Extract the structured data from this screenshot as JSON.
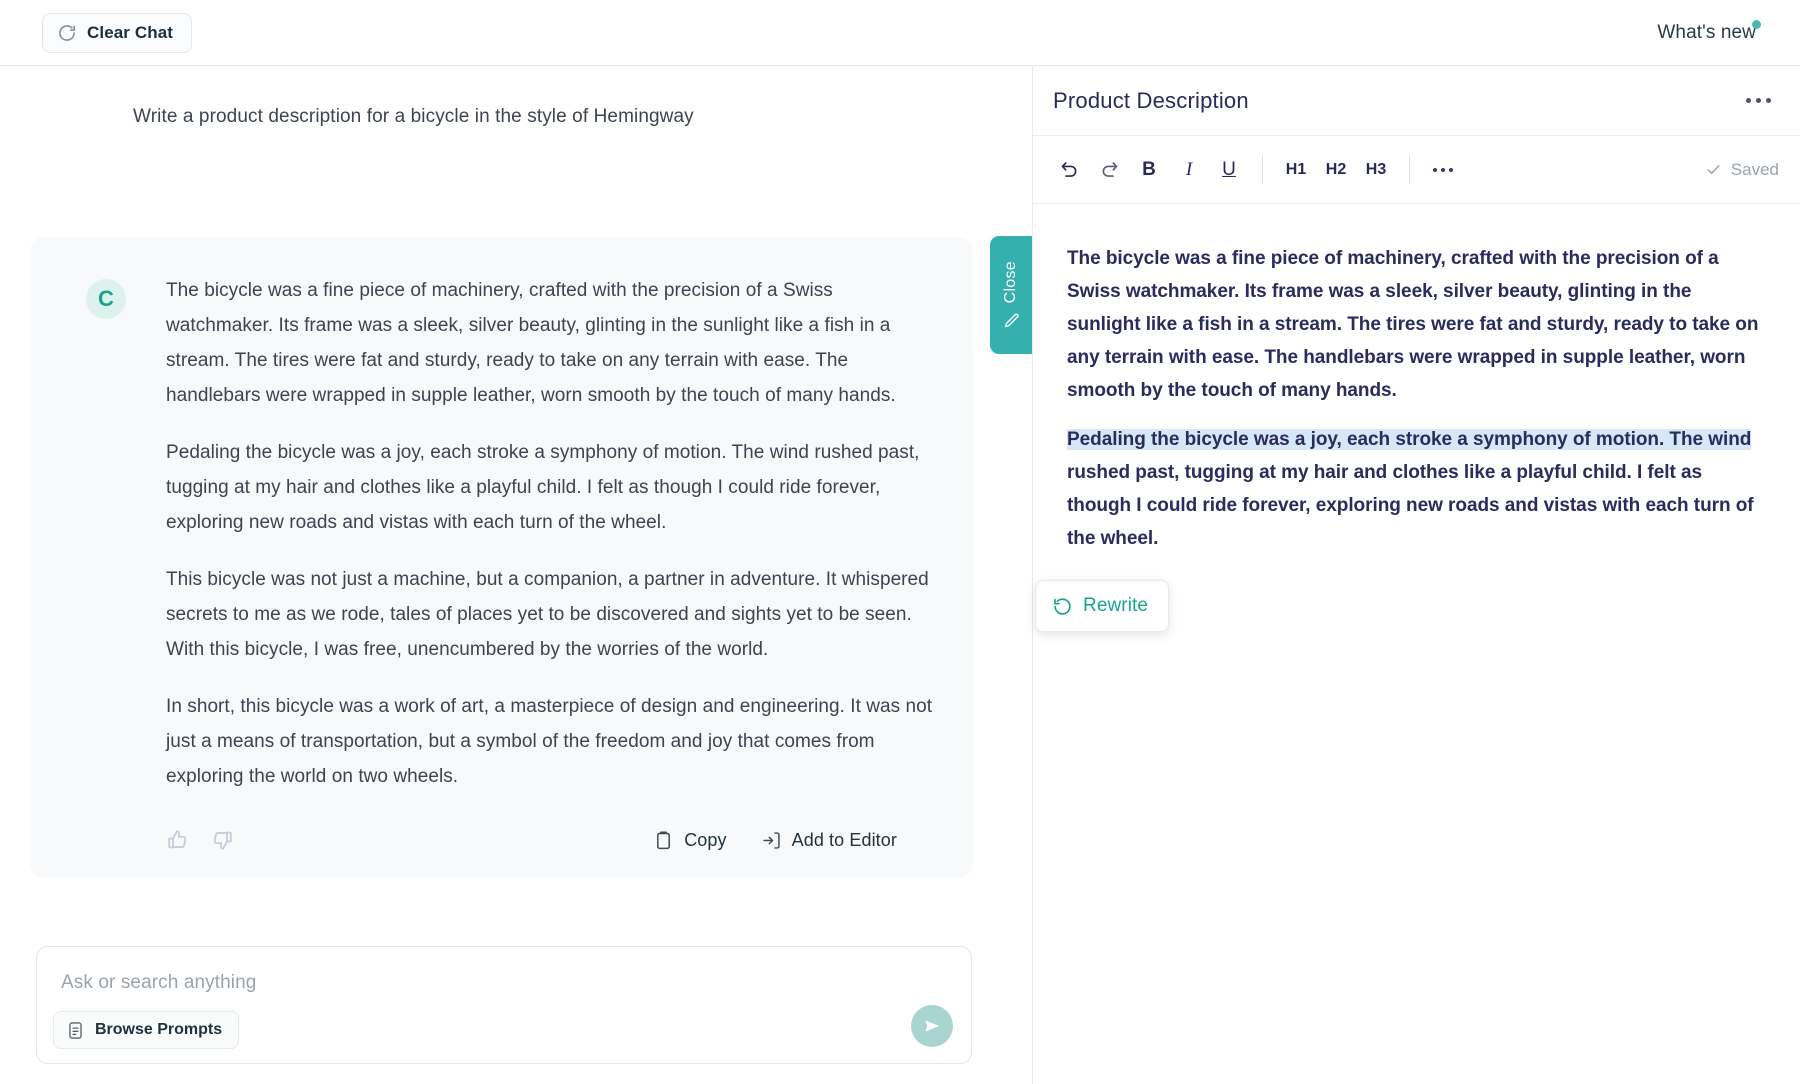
{
  "topbar": {
    "clear_chat_label": "Clear Chat",
    "clear_chat_icon": "refresh-icon",
    "whats_new_label": "What's new",
    "accent_color": "#4bb8b0"
  },
  "chat": {
    "user_prompt": "Write a product description for a bicycle in the style of Hemingway",
    "assistant": {
      "avatar_letter": "C",
      "paragraphs": [
        "The bicycle was a fine piece of machinery, crafted with the precision of a Swiss watchmaker. Its frame was a sleek, silver beauty, glinting in the sunlight like a fish in a stream. The tires were fat and sturdy, ready to take on any terrain with ease. The handlebars were wrapped in supple leather, worn smooth by the touch of many hands.",
        "Pedaling the bicycle was a joy, each stroke a symphony of motion. The wind rushed past, tugging at my hair and clothes like a playful child. I felt as though I could ride forever, exploring new roads and vistas with each turn of the wheel.",
        "This bicycle was not just a machine, but a companion, a partner in adventure. It whispered secrets to me as we rode, tales of places yet to be discovered and sights yet to be seen. With this bicycle, I was free, unencumbered by the worries of the world.",
        "In short, this bicycle was a work of art, a masterpiece of design and engineering. It was not just a means of transportation, but a symbol of the freedom and joy that comes from exploring the world on two wheels."
      ],
      "actions": {
        "thumbs_up_icon": "thumbs-up-icon",
        "thumbs_down_icon": "thumbs-down-icon",
        "copy_label": "Copy",
        "copy_icon": "clipboard-icon",
        "add_to_editor_label": "Add to Editor",
        "add_to_editor_icon": "add-to-editor-icon"
      }
    }
  },
  "composer": {
    "placeholder": "Ask or search anything",
    "value": "",
    "browse_prompts_label": "Browse Prompts",
    "browse_prompts_icon": "prompt-list-icon",
    "send_icon": "send-icon",
    "send_button_color": "#a9d5d1"
  },
  "close_tab": {
    "label": "Close",
    "icon": "pen-edit-icon",
    "color": "#36b0ae"
  },
  "editor": {
    "title": "Product Description",
    "menu_icon": "more-options-icon",
    "toolbar": {
      "undo_icon": "undo-icon",
      "redo_icon": "redo-icon",
      "bold_label": "B",
      "italic_label": "I",
      "underline_label": "U",
      "h1_label": "H1",
      "h2_label": "H2",
      "h3_label": "H3",
      "more_icon": "more-formatting-icon",
      "saved_label": "Saved",
      "saved_icon": "check-icon"
    },
    "paragraphs": [
      {
        "selected_text": "",
        "text": "The bicycle was a fine piece of machinery, crafted with the precision of a Swiss watchmaker. Its frame was a sleek, silver beauty, glinting in the sunlight like a fish in a stream. The tires were fat and sturdy, ready to take on any terrain with ease. The handlebars were wrapped in supple leather, worn smooth by the touch of many hands."
      },
      {
        "selected_text": "Pedaling the bicycle was a joy, each stroke a symphony of motion. The wind",
        "text": " rushed past, tugging at my hair and clothes like a playful child. I felt as though I could ride forever, exploring new roads and vistas with each turn of the wheel."
      }
    ],
    "selection_color": "#d6e8f7"
  },
  "rewrite_popup": {
    "label": "Rewrite",
    "icon": "rewrite-refresh-icon",
    "color": "#17a391"
  }
}
